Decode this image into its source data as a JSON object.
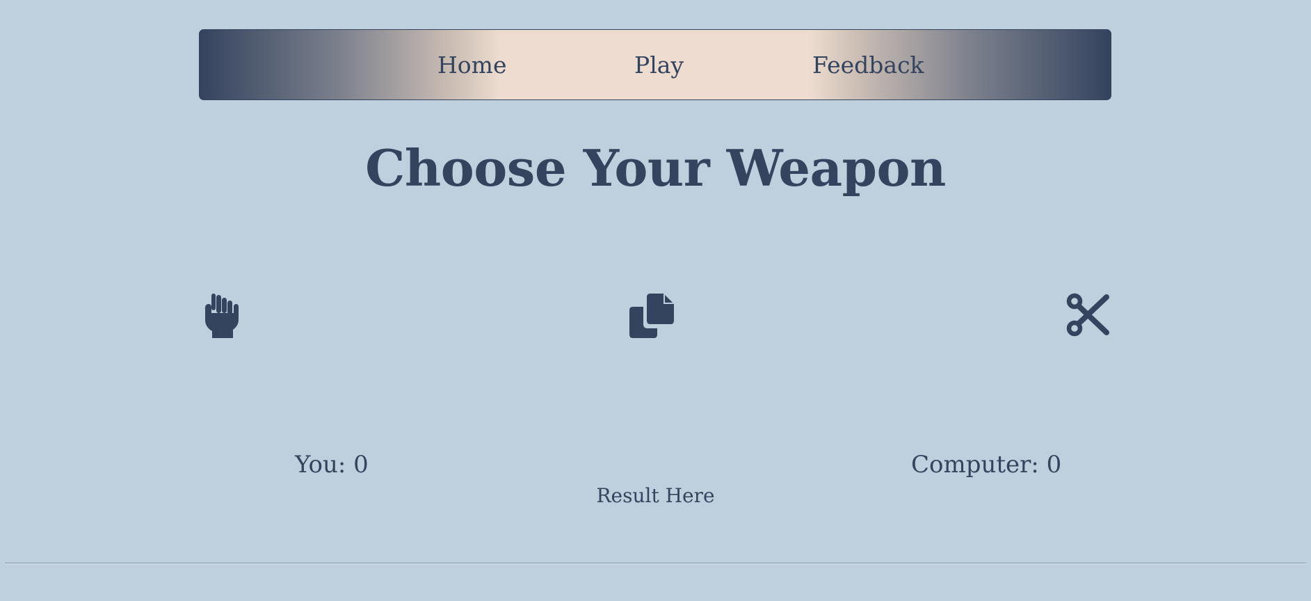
{
  "nav": {
    "items": [
      {
        "label": "Home"
      },
      {
        "label": "Play"
      },
      {
        "label": "Feedback"
      }
    ]
  },
  "main": {
    "title": "Choose Your Weapon",
    "weapons": [
      {
        "icon": "hand-rock-icon"
      },
      {
        "icon": "copy-icon"
      },
      {
        "icon": "scissors-icon"
      }
    ],
    "scores": {
      "you": "You: 0",
      "computer": "Computer: 0"
    },
    "result": "Result Here"
  },
  "colors": {
    "background": "#bed0de",
    "primary": "#34435e",
    "nav_center": "#eddccf"
  }
}
